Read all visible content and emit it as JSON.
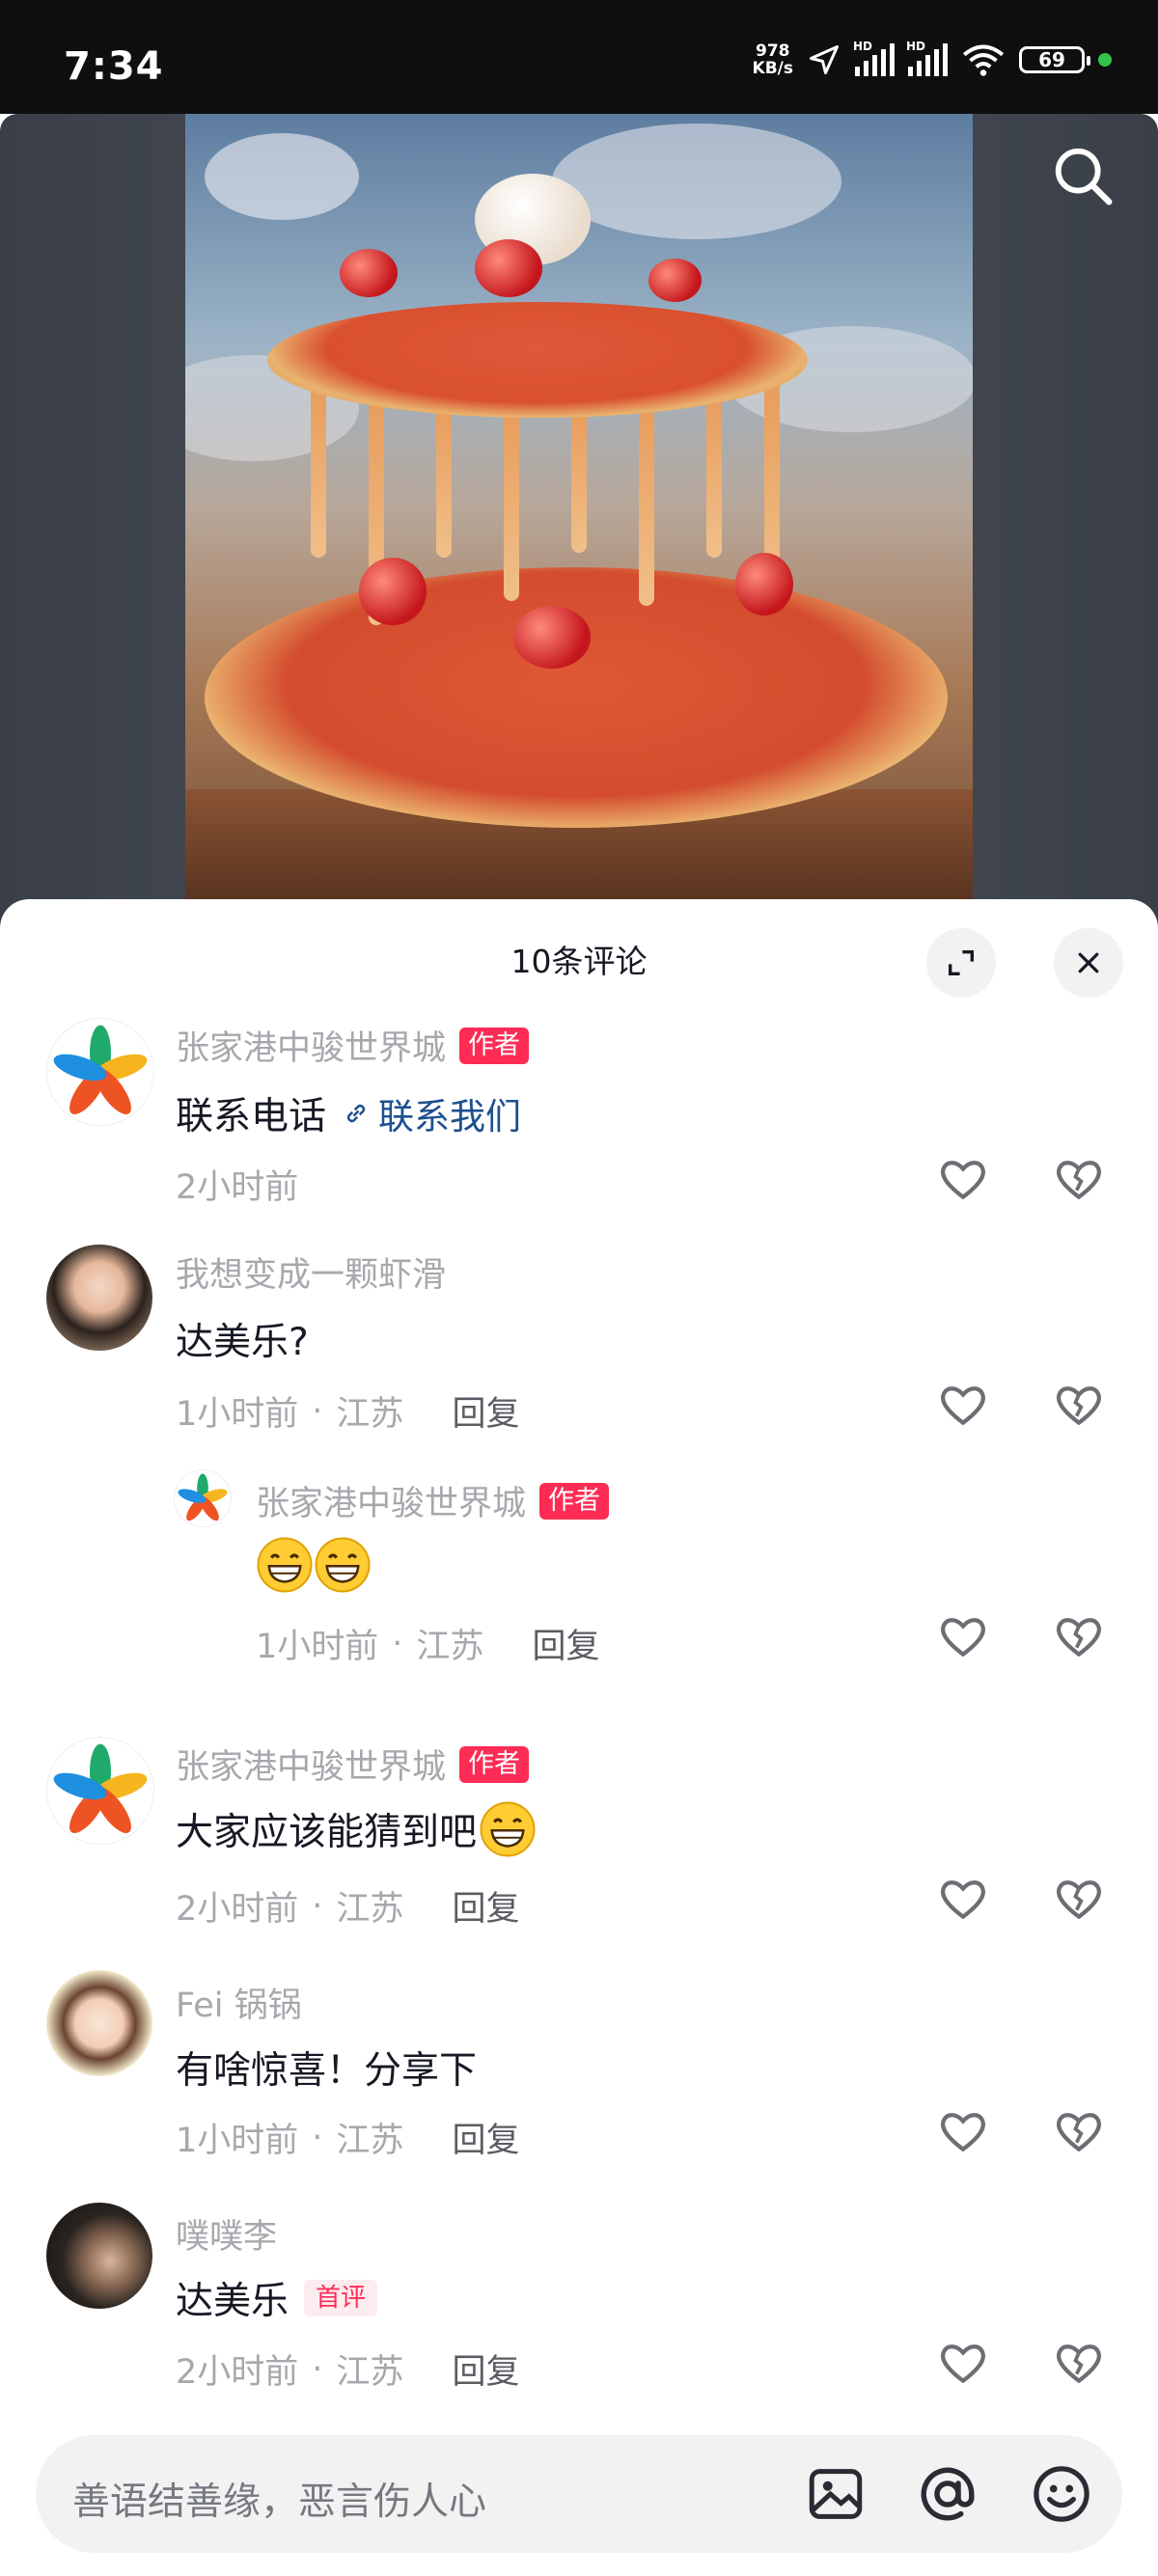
{
  "status_bar": {
    "time": "7:34",
    "net_speed_value": "978",
    "net_speed_unit": "KB/s",
    "sim1": "HD",
    "sim2": "HD",
    "battery": "69"
  },
  "sheet": {
    "title": "10条评论"
  },
  "comments": [
    {
      "username": "张家港中骏世界城",
      "badge": "作者",
      "text": "联系电话",
      "link": "联系我们",
      "time": "2小时前"
    },
    {
      "username": "我想变成一颗虾滑",
      "text": "达美乐?",
      "time": "1小时前",
      "location": "江苏",
      "reply": "回复"
    },
    {
      "username": "张家港中骏世界城",
      "badge": "作者",
      "text": "",
      "time": "1小时前",
      "location": "江苏",
      "reply": "回复"
    },
    {
      "username": "张家港中骏世界城",
      "badge": "作者",
      "text": "大家应该能猜到吧",
      "time": "2小时前",
      "location": "江苏",
      "reply": "回复"
    },
    {
      "username": "Fei 锅锅",
      "text": "有啥惊喜！分享下",
      "time": "1小时前",
      "location": "江苏",
      "reply": "回复"
    },
    {
      "username": "噗噗李",
      "text": "达美乐",
      "first_badge": "首评",
      "time": "2小时前",
      "location": "江苏",
      "reply": "回复"
    }
  ],
  "meta_separator": "·",
  "input": {
    "placeholder": "善语结善缘，恶言伤人心"
  },
  "icons": [
    "search-icon",
    "expand-icon",
    "close-icon",
    "link-icon",
    "like-icon",
    "dislike-icon",
    "image-icon",
    "at-icon",
    "emoji-icon",
    "grin-emoji"
  ],
  "colors": {
    "accent": "#fe2c55",
    "link": "#1d4f8f",
    "secondary_text": "#a7a8ad"
  }
}
